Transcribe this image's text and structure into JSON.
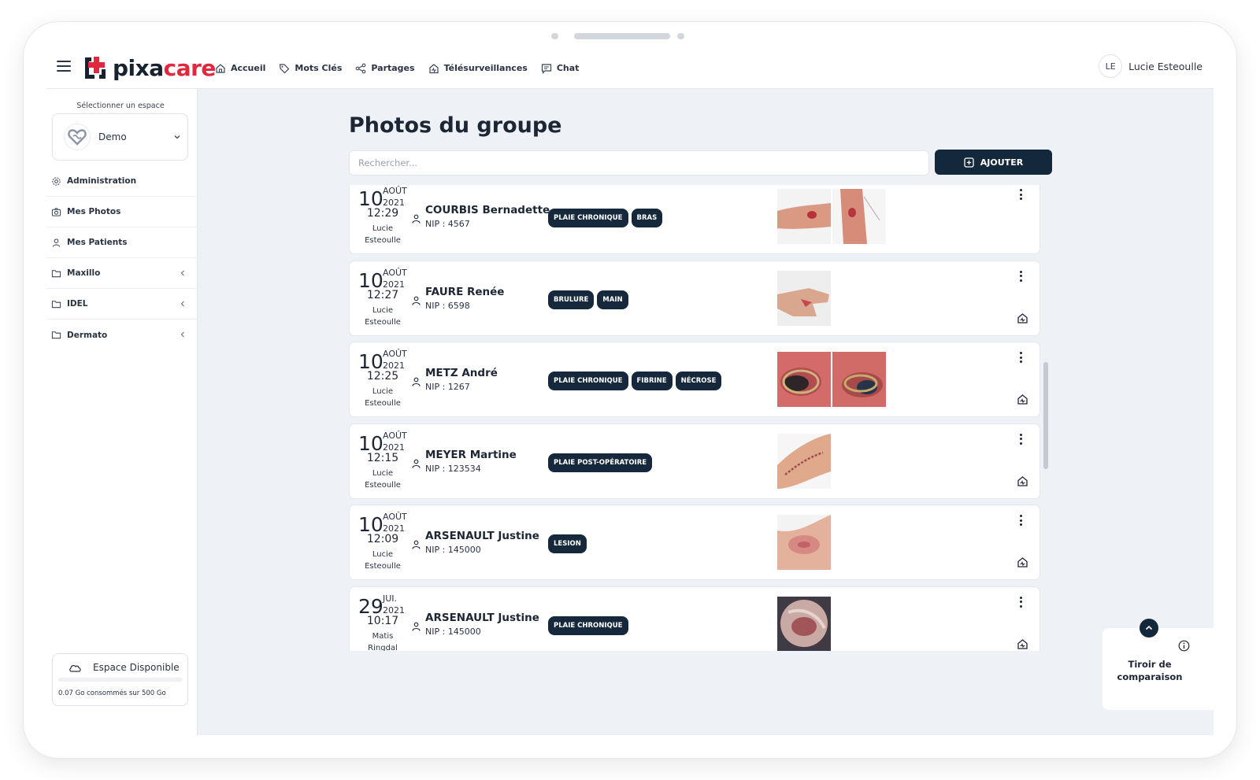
{
  "app": {
    "name_part1": "pixa",
    "name_part2": "care"
  },
  "nav": [
    {
      "label": "Accueil",
      "icon": "home-icon"
    },
    {
      "label": "Mots Clés",
      "icon": "tag-icon"
    },
    {
      "label": "Partages",
      "icon": "share-icon"
    },
    {
      "label": "Télésurveillances",
      "icon": "telemonitoring-icon"
    },
    {
      "label": "Chat",
      "icon": "chat-icon"
    }
  ],
  "user": {
    "initials": "LE",
    "name": "Lucie Esteoulle"
  },
  "sidebar": {
    "space_label": "Sélectionner un espace",
    "space_name": "Demo",
    "items": [
      {
        "label": "Administration",
        "icon": "gear-icon"
      },
      {
        "label": "Mes Photos",
        "icon": "camera-icon"
      },
      {
        "label": "Mes Patients",
        "icon": "user-icon"
      },
      {
        "label": "Maxillo",
        "icon": "folder-icon"
      },
      {
        "label": "IDEL",
        "icon": "folder-icon"
      },
      {
        "label": "Dermato",
        "icon": "folder-icon"
      }
    ],
    "storage": {
      "title": "Espace Disponible",
      "used_text": "0.07 Go consommés sur 500 Go",
      "fraction": 0.0
    }
  },
  "main": {
    "title": "Photos du groupe",
    "search_placeholder": "Rechercher...",
    "add_label": "AJOUTER"
  },
  "photos": [
    {
      "day": "10",
      "month": "AOÛT",
      "year": "2021",
      "time": "12:29",
      "author1": "Lucie",
      "author2": "Esteoulle",
      "name": "COURBIS Bernadette",
      "nip": "NIP : 4567",
      "tags": [
        "PLAIE CHRONIQUE",
        "BRAS"
      ],
      "thumbs": 2
    },
    {
      "day": "10",
      "month": "AOÛT",
      "year": "2021",
      "time": "12:27",
      "author1": "Lucie",
      "author2": "Esteoulle",
      "name": "FAURE Renée",
      "nip": "NIP : 6598",
      "tags": [
        "BRULURE",
        "MAIN"
      ],
      "thumbs": 1
    },
    {
      "day": "10",
      "month": "AOÛT",
      "year": "2021",
      "time": "12:25",
      "author1": "Lucie",
      "author2": "Esteoulle",
      "name": "METZ André",
      "nip": "NIP : 1267",
      "tags": [
        "PLAIE CHRONIQUE",
        "FIBRINE",
        "NÉCROSE"
      ],
      "thumbs": 2
    },
    {
      "day": "10",
      "month": "AOÛT",
      "year": "2021",
      "time": "12:15",
      "author1": "Lucie",
      "author2": "Esteoulle",
      "name": "MEYER Martine",
      "nip": "NIP : 123534",
      "tags": [
        "PLAIE POST-OPÉRATOIRE"
      ],
      "thumbs": 1
    },
    {
      "day": "10",
      "month": "AOÛT",
      "year": "2021",
      "time": "12:09",
      "author1": "Lucie",
      "author2": "Esteoulle",
      "name": "ARSENAULT Justine",
      "nip": "NIP : 145000",
      "tags": [
        "LESION"
      ],
      "thumbs": 1
    },
    {
      "day": "29",
      "month": "JUI.",
      "year": "2021",
      "time": "10:17",
      "author1": "Matis",
      "author2": "Ringdal",
      "name": "ARSENAULT Justine",
      "nip": "NIP : 145000",
      "tags": [
        "PLAIE CHRONIQUE"
      ],
      "thumbs": 1
    }
  ],
  "drawer": {
    "label_line1": "Tiroir de",
    "label_line2": "comparaison"
  }
}
